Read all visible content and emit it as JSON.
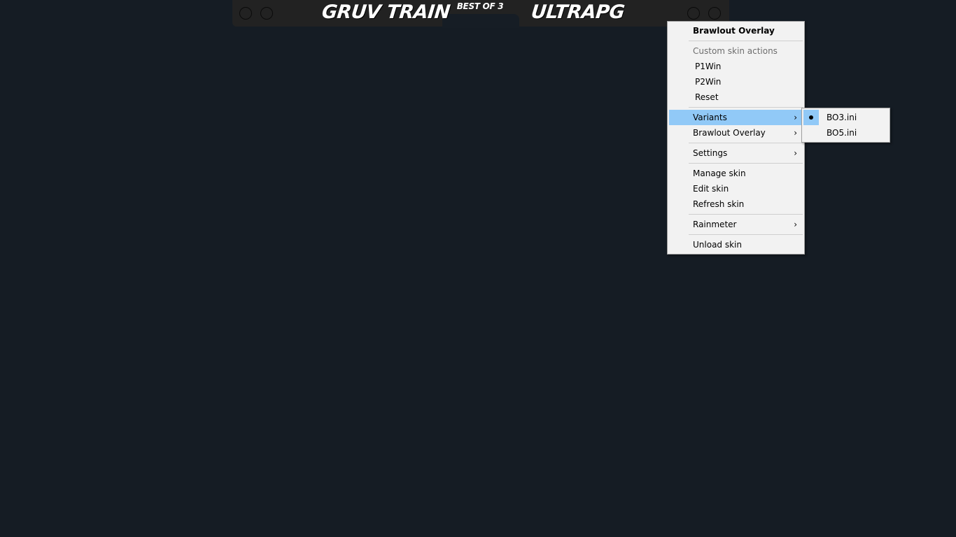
{
  "overlay": {
    "player1": "Gruv Train",
    "player2": "UltraPG",
    "best_of": "Best of 3"
  },
  "menu": {
    "title": "Brawlout Overlay",
    "custom_header": "Custom skin actions",
    "p1win": "P1Win",
    "p2win": "P2Win",
    "reset": "Reset",
    "variants": "Variants",
    "brawlout_overlay": "Brawlout Overlay",
    "settings": "Settings",
    "manage_skin": "Manage skin",
    "edit_skin": "Edit skin",
    "refresh_skin": "Refresh skin",
    "rainmeter": "Rainmeter",
    "unload_skin": "Unload skin",
    "chevron": "›"
  },
  "variants_submenu": {
    "items": [
      {
        "label": "BO3.ini",
        "selected": true
      },
      {
        "label": "BO5.ini",
        "selected": false
      }
    ]
  },
  "colors": {
    "background": "#151c24",
    "overlay_bar": "#222222",
    "menu_bg": "#f2f2f2",
    "highlight": "#91c9f7"
  }
}
